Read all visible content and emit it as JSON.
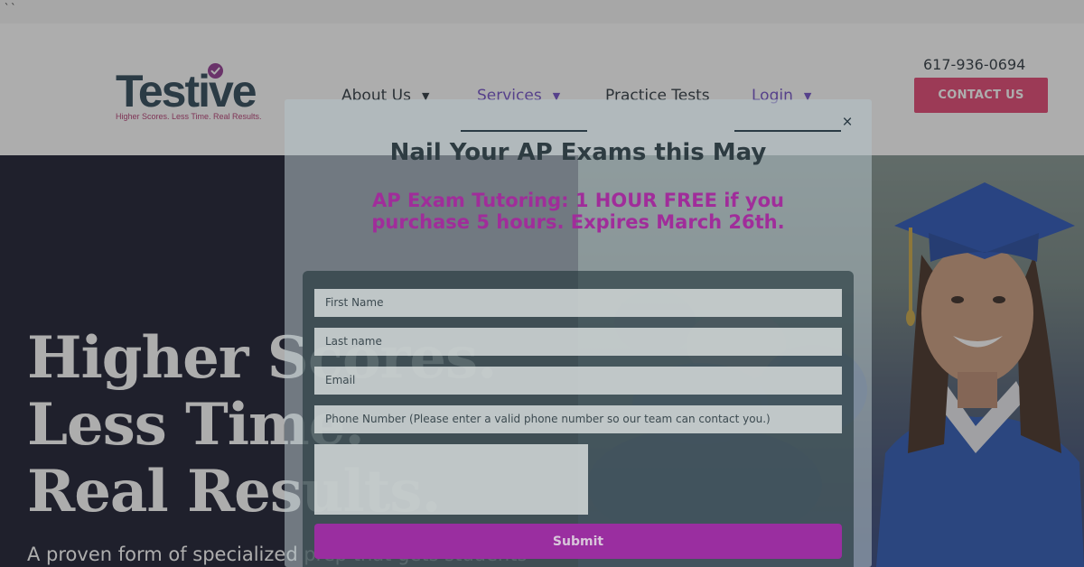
{
  "code_strip": {
    "text": "``"
  },
  "header": {
    "logo": {
      "word": "Testive",
      "tagline": "Higher Scores. Less Time. Real Results."
    },
    "nav": [
      {
        "label": "About Us",
        "has_dropdown": true
      },
      {
        "label": "Services",
        "has_dropdown": true
      },
      {
        "label": "Practice Tests",
        "has_dropdown": false
      },
      {
        "label": "Login",
        "has_dropdown": true
      }
    ],
    "phone": "617-936-0694",
    "contact_label": "CONTACT US"
  },
  "hero": {
    "headline": [
      "Higher Scores.",
      "Less Time.",
      "Real Results."
    ],
    "subtext": "A proven form of specialized prep that gets students"
  },
  "modal": {
    "close_glyph": "×",
    "title": "Nail Your AP Exams this May",
    "promo_line1": "AP Exam Tutoring: 1 HOUR FREE if you",
    "promo_line2": "purchase 5 hours. Expires March 26th.",
    "form": {
      "first_name_placeholder": "First Name",
      "last_name_placeholder": "Last name",
      "email_placeholder": "Email",
      "phone_placeholder": "Phone Number (Please enter a valid phone number so our team can contact you.)",
      "submit_label": "Submit"
    }
  },
  "colors": {
    "brand_navy": "#1f3b4d",
    "brand_purple": "#6a45c4",
    "contact_pink": "#e23a6a",
    "promo_magenta": "#a02d9a",
    "hero_bg": "#0b0d22"
  },
  "icons": {
    "logo_badge": "check-circle-icon",
    "dropdown": "caret-down-icon",
    "close": "close-icon"
  }
}
